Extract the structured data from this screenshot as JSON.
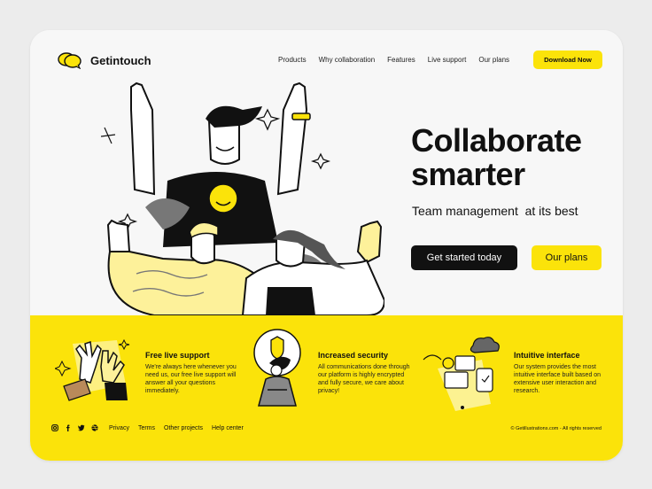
{
  "brand": {
    "name": "Getintouch"
  },
  "nav": {
    "items": [
      "Products",
      "Why collaboration",
      "Features",
      "Live support",
      "Our plans"
    ],
    "download_label": "Download Now"
  },
  "hero": {
    "headline_line1": "Collaborate",
    "headline_line2": "smarter",
    "subheadline": "Team management  at its best",
    "primary_cta": "Get started today",
    "secondary_cta": "Our plans"
  },
  "features": [
    {
      "title": "Free live support",
      "description": "We're always here whenever you need us, our free live support will answer all your questions immediately."
    },
    {
      "title": "Increased security",
      "description": "All communications done through our platform is highly encrypted and fully secure, we care about privacy!"
    },
    {
      "title": "Intuitive interface",
      "description": "Our system provides the most intuitive interface built based on extensive user interaction and research."
    }
  ],
  "footer": {
    "social_icons": [
      "instagram-icon",
      "facebook-icon",
      "twitter-icon",
      "dribbble-icon"
    ],
    "links": [
      "Privacy",
      "Terms",
      "Other projects",
      "Help center"
    ],
    "copyright": "© Getillustrations.com - All rights reserved"
  },
  "colors": {
    "accent": "#fbe30a",
    "dark": "#111111",
    "background": "#ececec",
    "card": "#f7f7f7"
  }
}
